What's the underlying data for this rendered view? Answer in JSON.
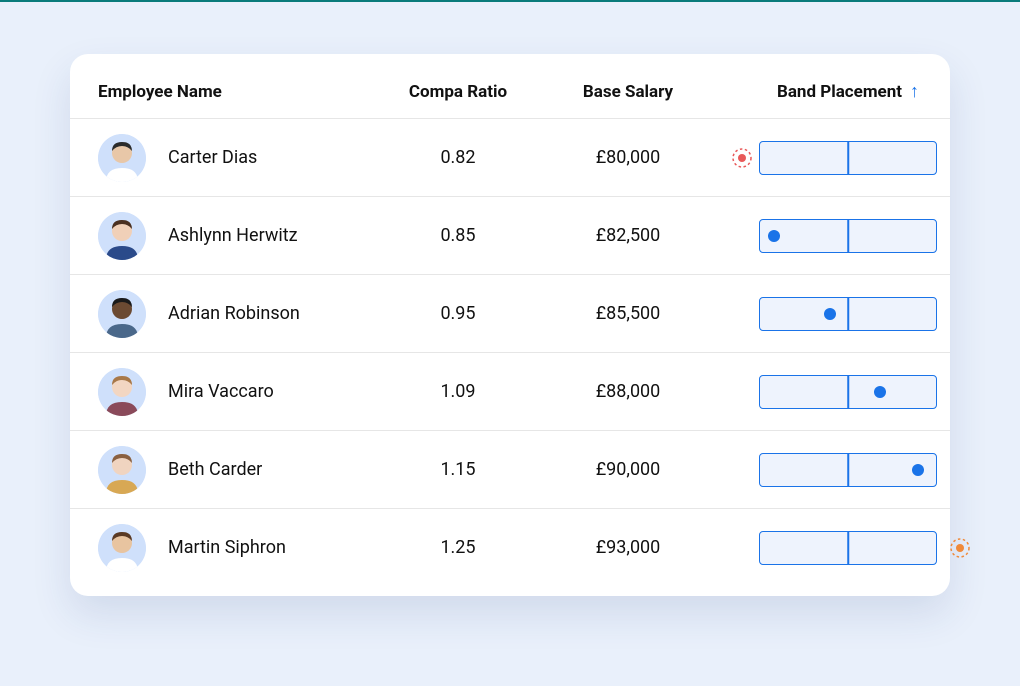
{
  "columns": {
    "employee": "Employee Name",
    "compa": "Compa Ratio",
    "salary": "Base Salary",
    "band": "Band Placement"
  },
  "sort_indicator": "↑",
  "colors": {
    "brand_blue": "#1a73e8",
    "below_red": "#e85a5a",
    "above_orange": "#f08a3a"
  },
  "employees": [
    {
      "name": "Carter Dias",
      "compa": "0.82",
      "salary": "£80,000",
      "band_pos": null,
      "out": "below",
      "avatar": {
        "skin": "#e8c7a8",
        "hair": "#2b2b2b",
        "shirt": "#ffffff"
      }
    },
    {
      "name": "Ashlynn Herwitz",
      "compa": "0.85",
      "salary": "£82,500",
      "band_pos": 0.08,
      "out": null,
      "avatar": {
        "skin": "#f0d0b8",
        "hair": "#4a3020",
        "shirt": "#2a4a8a"
      }
    },
    {
      "name": "Adrian Robinson",
      "compa": "0.95",
      "salary": "£85,500",
      "band_pos": 0.4,
      "out": null,
      "avatar": {
        "skin": "#6b4a32",
        "hair": "#1a1a1a",
        "shirt": "#4a688a"
      }
    },
    {
      "name": "Mira Vaccaro",
      "compa": "1.09",
      "salary": "£88,000",
      "band_pos": 0.68,
      "out": null,
      "avatar": {
        "skin": "#f2d6c2",
        "hair": "#a87848",
        "shirt": "#8a4a5a"
      }
    },
    {
      "name": "Beth Carder",
      "compa": "1.15",
      "salary": "£90,000",
      "band_pos": 0.9,
      "out": null,
      "avatar": {
        "skin": "#f0d4c0",
        "hair": "#8a6040",
        "shirt": "#d8a854"
      }
    },
    {
      "name": "Martin Siphron",
      "compa": "1.25",
      "salary": "£93,000",
      "band_pos": null,
      "out": "above",
      "avatar": {
        "skin": "#e8c4a0",
        "hair": "#5a3a24",
        "shirt": "#ffffff"
      }
    }
  ]
}
